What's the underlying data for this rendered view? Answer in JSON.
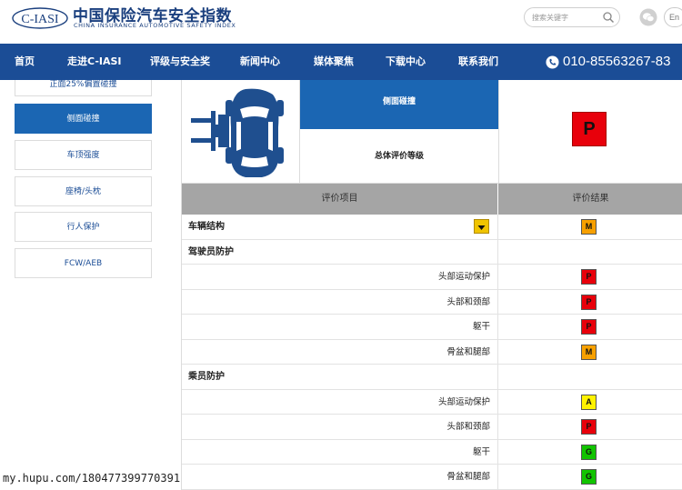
{
  "header": {
    "logo_text": "C-IASI",
    "brand_cn": "中国保险汽车安全指数",
    "brand_en": "CHINA INSURANCE AUTOMOTIVE SAFETY INDEX",
    "search_placeholder": "搜索关键字",
    "lang_label": "En"
  },
  "nav": {
    "items": [
      "首页",
      "走进C-IASI",
      "评级与安全奖",
      "新闻中心",
      "媒体聚焦",
      "下载中心",
      "联系我们"
    ],
    "phone": "010-85563267-83"
  },
  "sidebar": {
    "top_partial": "正面25%偏置碰撞",
    "items": [
      "侧面碰撞",
      "车顶强度",
      "座椅/头枕",
      "行人保护",
      "FCW/AEB"
    ],
    "active_index": 0
  },
  "main": {
    "test_name": "侧面碰撞",
    "overall_label": "总体评价等级",
    "overall_rating": "P",
    "overall_rating_color": "#e8000b",
    "table_header": {
      "item": "评价项目",
      "result": "评价结果"
    },
    "rows": [
      {
        "label": "车辆结构",
        "type": "section",
        "rating": "M",
        "expandable": true
      },
      {
        "label": "驾驶员防护",
        "type": "section",
        "rating": ""
      },
      {
        "label": "头部运动保护",
        "type": "sub",
        "rating": "P"
      },
      {
        "label": "头部和颈部",
        "type": "sub",
        "rating": "P"
      },
      {
        "label": "躯干",
        "type": "sub",
        "rating": "P"
      },
      {
        "label": "骨盆和腿部",
        "type": "sub",
        "rating": "M"
      },
      {
        "label": "乘员防护",
        "type": "section",
        "rating": ""
      },
      {
        "label": "头部运动保护",
        "type": "sub",
        "rating": "A"
      },
      {
        "label": "头部和颈部",
        "type": "sub",
        "rating": "P"
      },
      {
        "label": "躯干",
        "type": "sub",
        "rating": "G"
      },
      {
        "label": "骨盆和腿部",
        "type": "sub",
        "rating": "G"
      }
    ],
    "rating_colors": {
      "G": "#11c400",
      "A": "#fff200",
      "M": "#f7a000",
      "P": "#e8000b"
    }
  },
  "watermark": "my.hupu.com/180477399770391"
}
